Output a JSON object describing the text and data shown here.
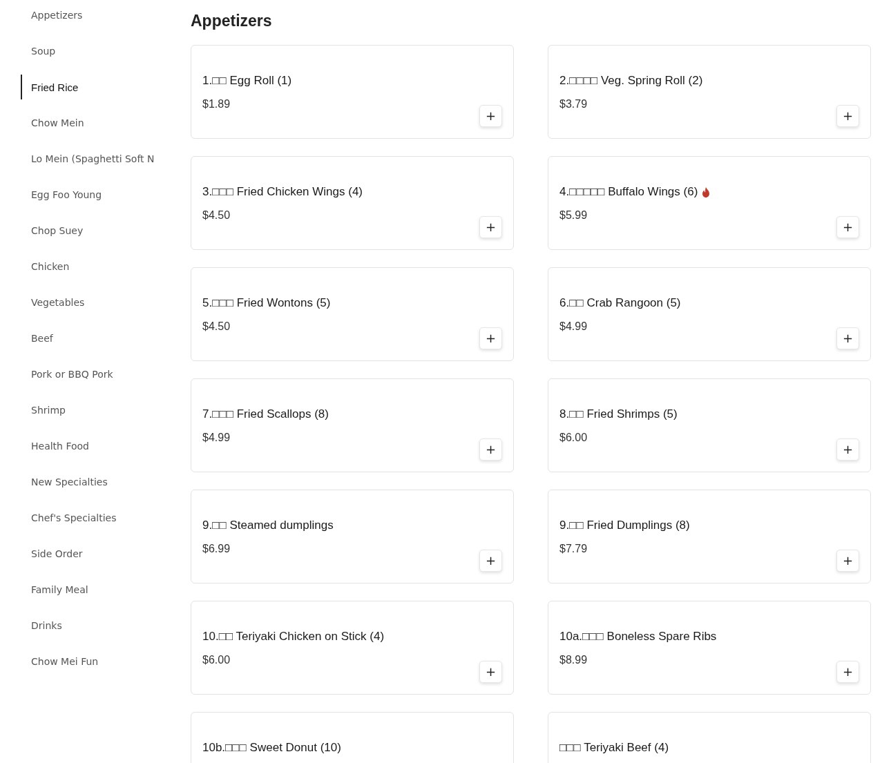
{
  "sidebar": {
    "items": [
      {
        "label": "Appetizers",
        "selected": false
      },
      {
        "label": "Soup",
        "selected": false
      },
      {
        "label": "Fried Rice",
        "selected": true
      },
      {
        "label": "Chow Mein",
        "selected": false
      },
      {
        "label": "Lo Mein (Spaghetti Soft N",
        "selected": false
      },
      {
        "label": "Egg Foo Young",
        "selected": false
      },
      {
        "label": "Chop Suey",
        "selected": false
      },
      {
        "label": "Chicken",
        "selected": false
      },
      {
        "label": "Vegetables",
        "selected": false
      },
      {
        "label": "Beef",
        "selected": false
      },
      {
        "label": "Pork or BBQ Pork",
        "selected": false
      },
      {
        "label": "Shrimp",
        "selected": false
      },
      {
        "label": "Health Food",
        "selected": false
      },
      {
        "label": "New Specialties",
        "selected": false
      },
      {
        "label": "Chef's Specialties",
        "selected": false
      },
      {
        "label": "Side Order",
        "selected": false
      },
      {
        "label": "Family Meal",
        "selected": false
      },
      {
        "label": "Drinks",
        "selected": false
      },
      {
        "label": "Chow Mei Fun",
        "selected": false
      }
    ]
  },
  "section": {
    "title": "Appetizers",
    "items": [
      {
        "name": "1.□□ Egg Roll (1)",
        "price": "$1.89",
        "spicy": false,
        "add_button": "+"
      },
      {
        "name": "2.□□□□ Veg. Spring Roll (2)",
        "price": "$3.79",
        "spicy": false,
        "add_button": "+"
      },
      {
        "name": "3.□□□ Fried Chicken Wings (4)",
        "price": "$4.50",
        "spicy": false,
        "add_button": "+"
      },
      {
        "name": "4.□□□□□ Buffalo Wings (6)",
        "price": "$5.99",
        "spicy": true,
        "add_button": "+"
      },
      {
        "name": "5.□□□ Fried Wontons (5)",
        "price": "$4.50",
        "spicy": false,
        "add_button": "+"
      },
      {
        "name": "6.□□ Crab Rangoon (5)",
        "price": "$4.99",
        "spicy": false,
        "add_button": "+"
      },
      {
        "name": "7.□□□ Fried Scallops (8)",
        "price": "$4.99",
        "spicy": false,
        "add_button": "+"
      },
      {
        "name": "8.□□ Fried Shrimps (5)",
        "price": "$6.00",
        "spicy": false,
        "add_button": "+"
      },
      {
        "name": "9.□□ Steamed dumplings",
        "price": "$6.99",
        "spicy": false,
        "add_button": "+"
      },
      {
        "name": "9.□□ Fried Dumplings (8)",
        "price": "$7.79",
        "spicy": false,
        "add_button": "+"
      },
      {
        "name": "10.□□ Teriyaki Chicken on Stick (4)",
        "price": "$6.00",
        "spicy": false,
        "add_button": "+"
      },
      {
        "name": "10a.□□□ Boneless Spare Ribs",
        "price": "$8.99",
        "spicy": false,
        "add_button": "+"
      },
      {
        "name": "10b.□□□ Sweet Donut (10)",
        "spicy": false
      },
      {
        "name": "□□□ Teriyaki Beef (4)",
        "spicy": false
      }
    ]
  }
}
